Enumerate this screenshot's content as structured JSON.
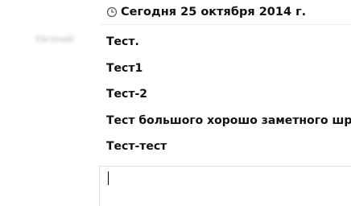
{
  "date_header": {
    "icon": "clock-icon",
    "text": "Сегодня 25 октября 2014 г."
  },
  "sender": {
    "name": "Евгений"
  },
  "messages": [
    {
      "text": "Тест."
    },
    {
      "text": "Тест1"
    },
    {
      "text": "Тест-2"
    },
    {
      "text": "Тест большого хорошо заметного шрифта"
    },
    {
      "text": "Тест-тест"
    }
  ],
  "composer": {
    "value": ""
  }
}
